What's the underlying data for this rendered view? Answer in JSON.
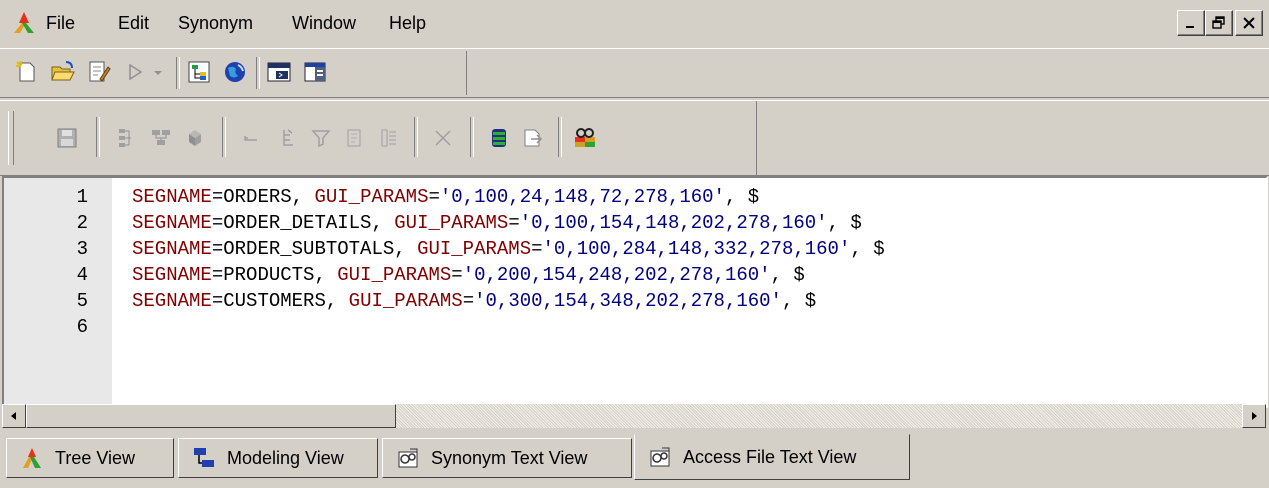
{
  "menubar": {
    "items": [
      "File",
      "Edit",
      "Synonym",
      "Window",
      "Help"
    ],
    "controls": {
      "minimize": "_",
      "restore": "̲❐",
      "close": "×"
    }
  },
  "toolbar1": {
    "buttons": [
      "new-icon",
      "open-folder-icon",
      "edit-document-icon",
      "run-icon",
      "dropdown-arrow-icon",
      "tree-view-icon",
      "globe-icon",
      "console-icon",
      "window-split-icon"
    ]
  },
  "toolbar2": {
    "buttons": [
      "save-icon",
      "join-icon",
      "segment-icon",
      "database-icon",
      "insert-row-icon",
      "indent-icon",
      "filter-icon",
      "properties-icon",
      "fields-icon",
      "delete-icon",
      "database-green-icon",
      "export-icon",
      "access-file-icon"
    ]
  },
  "editor": {
    "lines": [
      {
        "num": "1",
        "seg": "ORDERS",
        "params": "'0,100,24,148,72,278,160'"
      },
      {
        "num": "2",
        "seg": "ORDER_DETAILS",
        "params": "'0,100,154,148,202,278,160'"
      },
      {
        "num": "3",
        "seg": "ORDER_SUBTOTALS",
        "params": "'0,100,284,148,332,278,160'"
      },
      {
        "num": "4",
        "seg": "PRODUCTS",
        "params": "'0,200,154,248,202,278,160'"
      },
      {
        "num": "5",
        "seg": "CUSTOMERS",
        "params": "'0,300,154,348,202,278,160'"
      },
      {
        "num": "6",
        "seg": "",
        "params": ""
      }
    ],
    "keyword_segname": "SEGNAME",
    "keyword_gui": "GUI_PARAMS",
    "terminator": "$"
  },
  "tabs": [
    {
      "label": "Tree View",
      "icon": "tree-icon",
      "active": false
    },
    {
      "label": "Modeling View",
      "icon": "modeling-icon",
      "active": false
    },
    {
      "label": "Synonym Text View",
      "icon": "text-view-icon",
      "active": false
    },
    {
      "label": "Access File Text View",
      "icon": "access-file-icon",
      "active": true
    }
  ],
  "colors": {
    "keyword": "#800000",
    "value": "#000080",
    "chrome": "#d4d0c8"
  }
}
